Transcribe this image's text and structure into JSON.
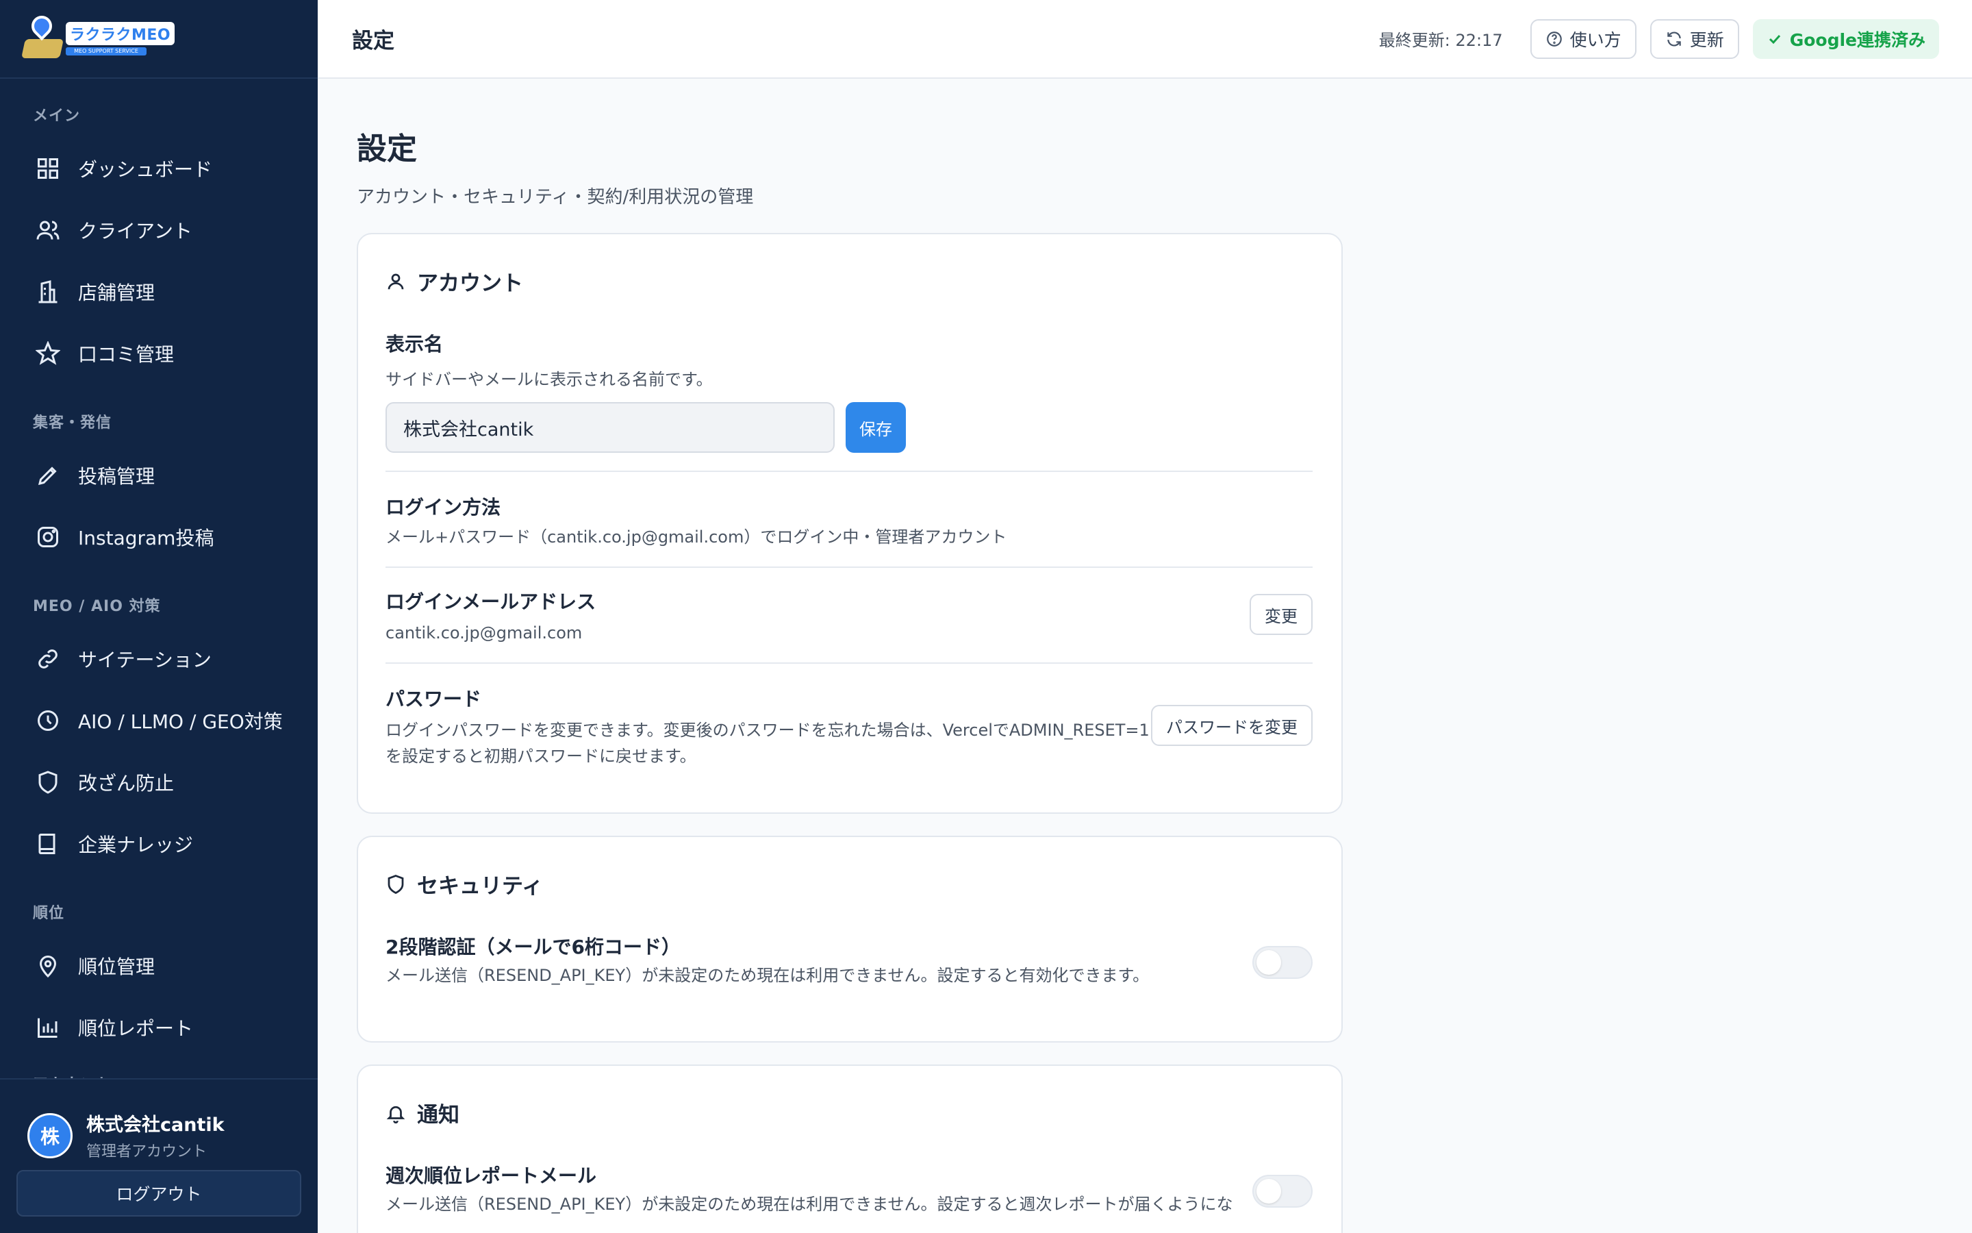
{
  "brand": {
    "name": "ラクラクMEO",
    "tagline": "MEO SUPPORT SERVICE"
  },
  "sidebar": {
    "sections": [
      {
        "title": "メイン",
        "items": [
          {
            "label": "ダッシュボード",
            "icon": "grid-icon"
          },
          {
            "label": "クライアント",
            "icon": "users-icon"
          },
          {
            "label": "店舗管理",
            "icon": "building-icon"
          },
          {
            "label": "口コミ管理",
            "icon": "star-icon"
          }
        ]
      },
      {
        "title": "集客・発信",
        "items": [
          {
            "label": "投稿管理",
            "icon": "pencil-icon"
          },
          {
            "label": "Instagram投稿",
            "icon": "instagram-icon"
          }
        ]
      },
      {
        "title": "MEO / AIO 対策",
        "items": [
          {
            "label": "サイテーション",
            "icon": "link-icon"
          },
          {
            "label": "AIO / LLMO / GEO対策",
            "icon": "clock-icon"
          },
          {
            "label": "改ざん防止",
            "icon": "shield-icon"
          },
          {
            "label": "企業ナレッジ",
            "icon": "book-icon"
          }
        ]
      },
      {
        "title": "順位",
        "items": [
          {
            "label": "順位管理",
            "icon": "location-pin-icon"
          },
          {
            "label": "順位レポート",
            "icon": "bar-chart-icon"
          }
        ]
      },
      {
        "title": "アカウント",
        "items": []
      }
    ],
    "user": {
      "avatar": "株",
      "name": "株式会社cantik",
      "role": "管理者アカウント"
    },
    "logout_label": "ログアウト"
  },
  "header": {
    "title": "設定",
    "last_updated": "最終更新: 22:17",
    "help_label": "使い方",
    "refresh_label": "更新",
    "google_label": "Google連携済み"
  },
  "page": {
    "title": "設定",
    "subtitle": "アカウント・セキュリティ・契約/利用状況の管理"
  },
  "account": {
    "heading": "アカウント",
    "display_name": {
      "label": "表示名",
      "desc": "サイドバーやメールに表示される名前です。",
      "value": "株式会社cantik",
      "save_label": "保存"
    },
    "login_method": {
      "label": "ログイン方法",
      "desc": "メール+パスワード（cantik.co.jp@gmail.com）でログイン中・管理者アカウント"
    },
    "login_email": {
      "label": "ログインメールアドレス",
      "value": "cantik.co.jp@gmail.com",
      "change_label": "変更"
    },
    "password": {
      "label": "パスワード",
      "desc_line1": "ログインパスワードを変更できます。変更後のパスワードを忘れた場合は、VercelでADMIN_RESET=1",
      "desc_line2": "を設定すると初期パスワードに戻せます。",
      "change_label": "パスワードを変更"
    }
  },
  "security": {
    "heading": "セキュリティ",
    "two_factor": {
      "label": "2段階認証（メールで6桁コード）",
      "desc": "メール送信（RESEND_API_KEY）が未設定のため現在は利用できません。設定すると有効化できます。",
      "enabled": false
    }
  },
  "notifications": {
    "heading": "通知",
    "weekly_report": {
      "label": "週次順位レポートメール",
      "desc": "メール送信（RESEND_API_KEY）が未設定のため現在は利用できません。設定すると週次レポートが届くようにな",
      "enabled": false
    }
  },
  "colors": {
    "sidebar_bg": "#112544",
    "accent": "#2f88ea",
    "success": "#16a34a"
  }
}
